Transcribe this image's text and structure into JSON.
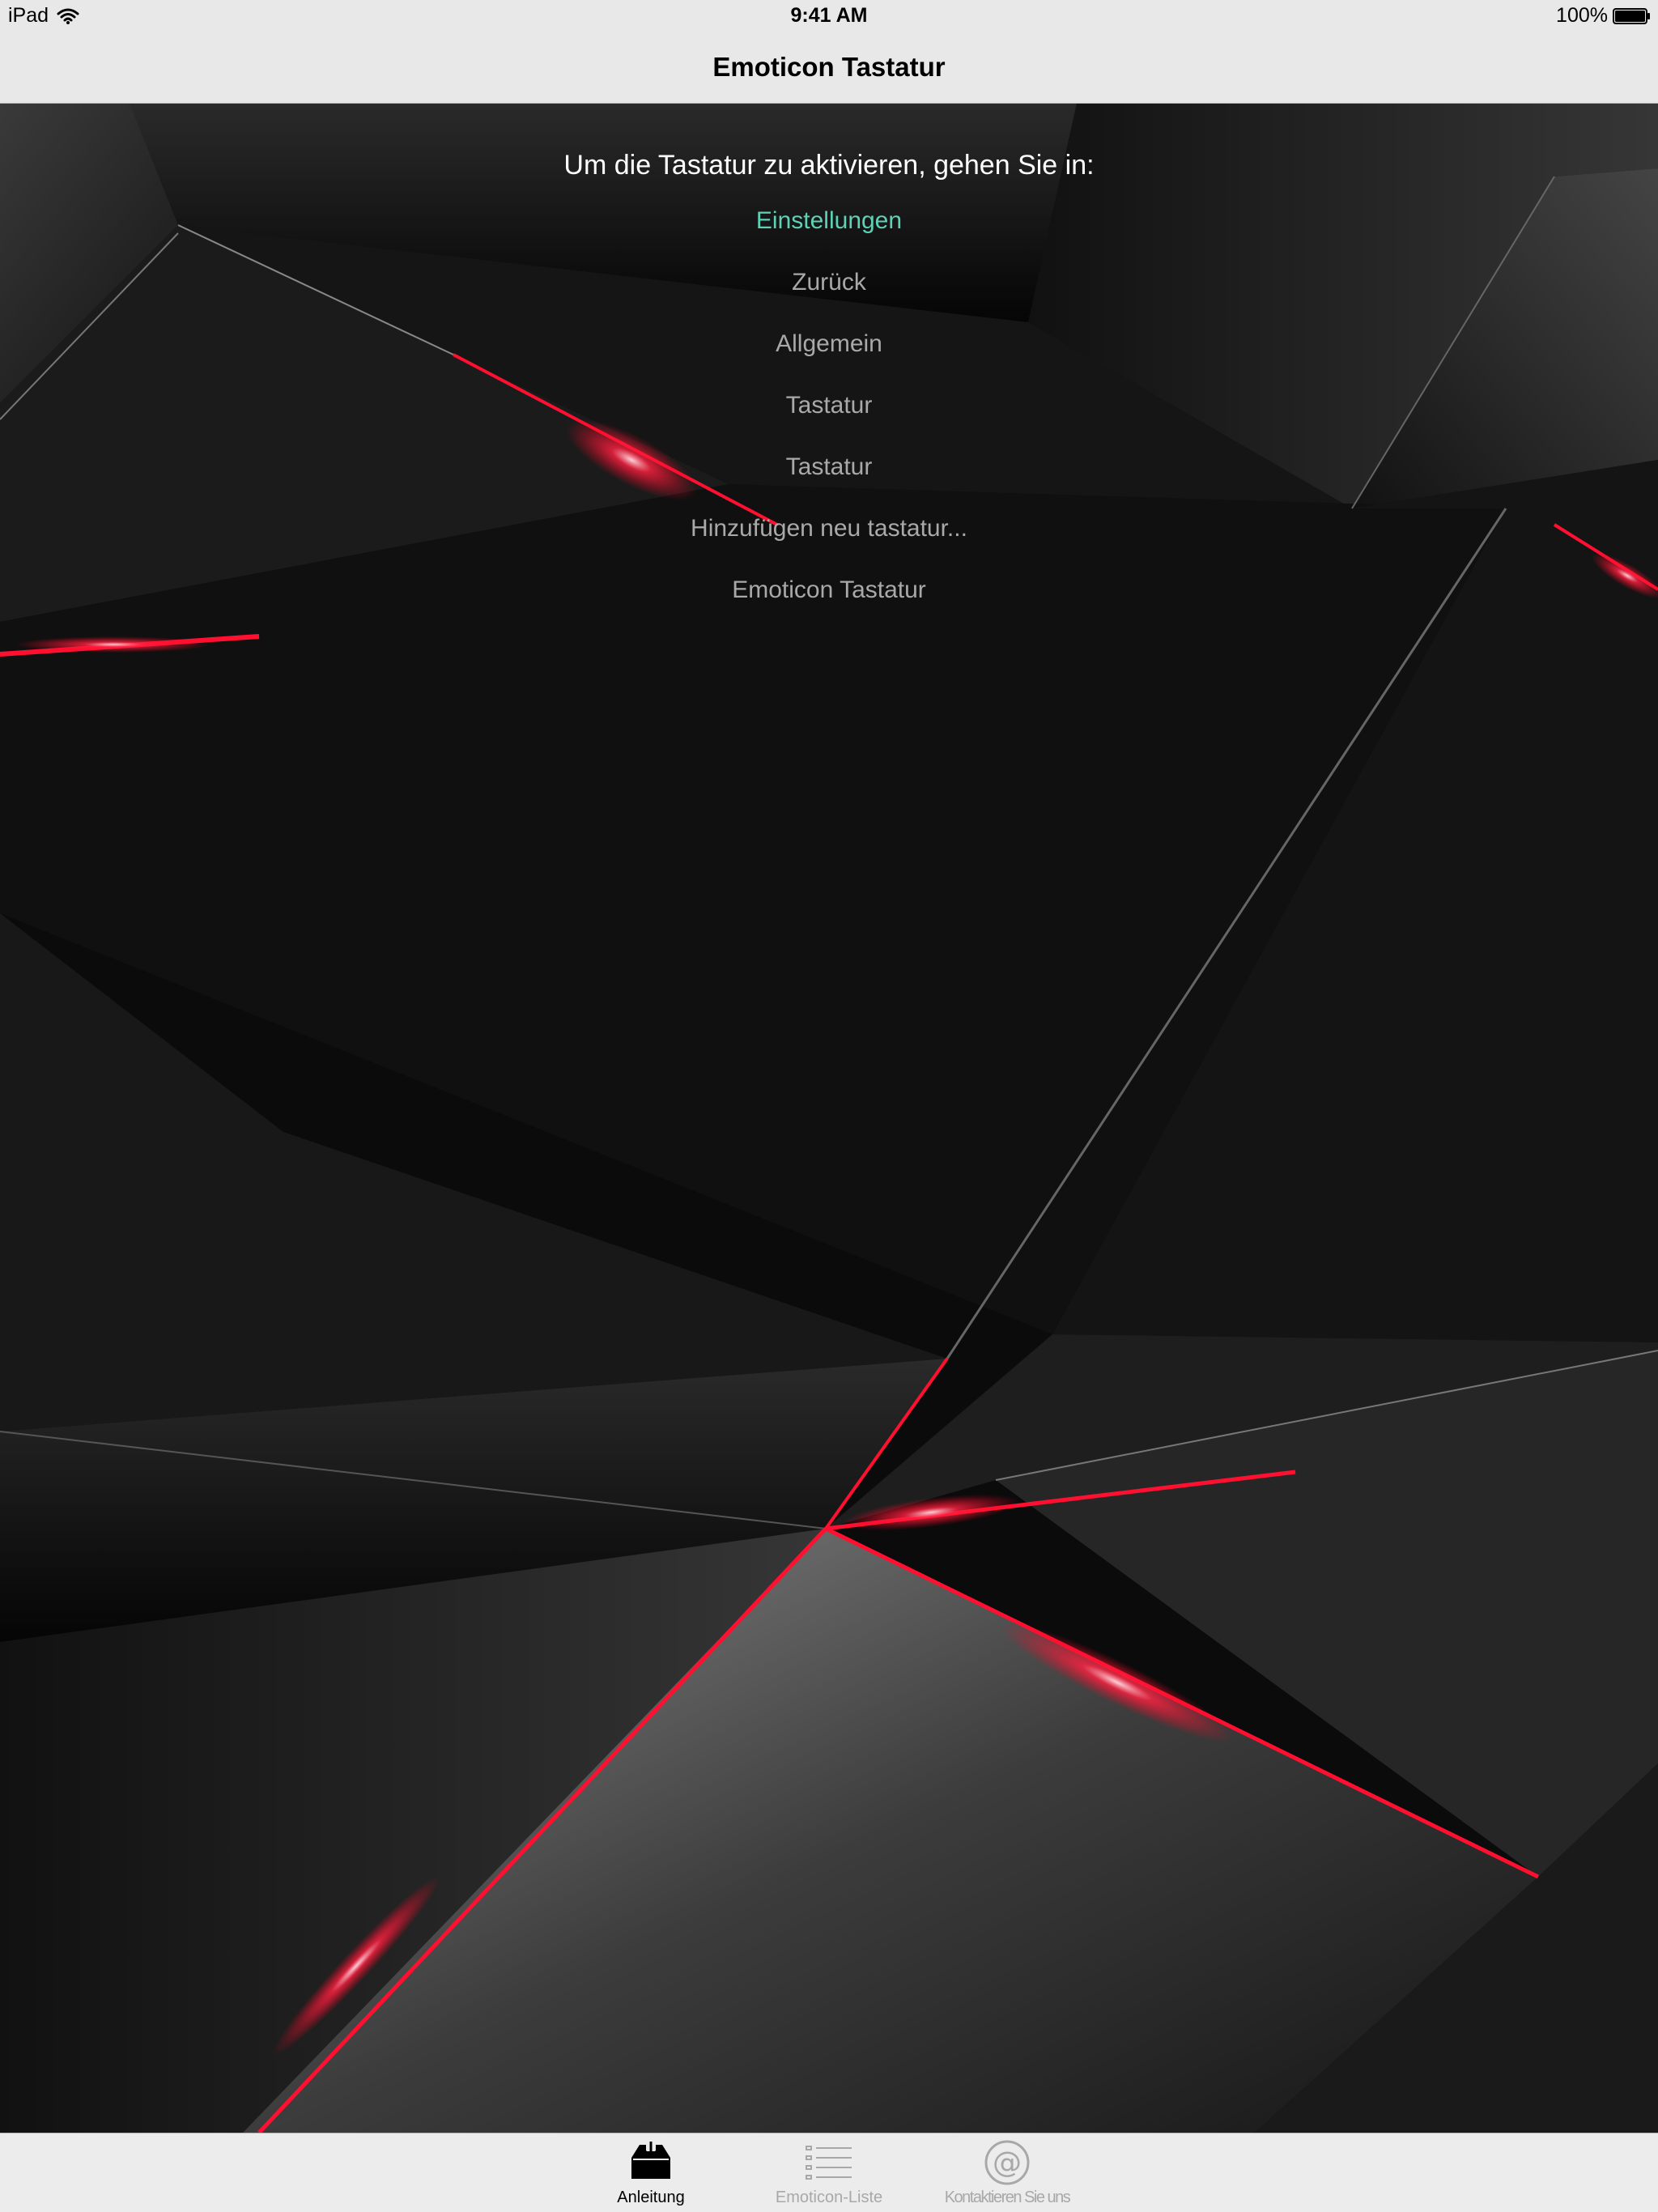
{
  "status_bar": {
    "carrier": "iPad",
    "time": "9:41 AM",
    "battery": "100%"
  },
  "nav": {
    "title": "Emoticon Tastatur"
  },
  "instructions": {
    "heading": "Um die Tastatur zu aktivieren, gehen Sie in:",
    "steps": [
      "Einstellungen",
      "Zurück",
      "Allgemein",
      "Tastatur",
      "Tastatur",
      "Hinzufügen neu tastatur...",
      "Emoticon Tastatur"
    ]
  },
  "tabs": [
    {
      "label": "Anleitung",
      "icon": "download-tray-icon",
      "selected": true
    },
    {
      "label": "Emoticon-Liste",
      "icon": "list-icon",
      "selected": false
    },
    {
      "label": "Kontaktieren Sie uns",
      "icon": "at-sign-icon",
      "selected": false
    }
  ],
  "colors": {
    "bar_background": "#e8e8e8",
    "link_accent": "#5fd1b5",
    "step_text": "#a9a9a9",
    "background_dark": "#0b0b0b",
    "glow_red": "#ff1030"
  }
}
